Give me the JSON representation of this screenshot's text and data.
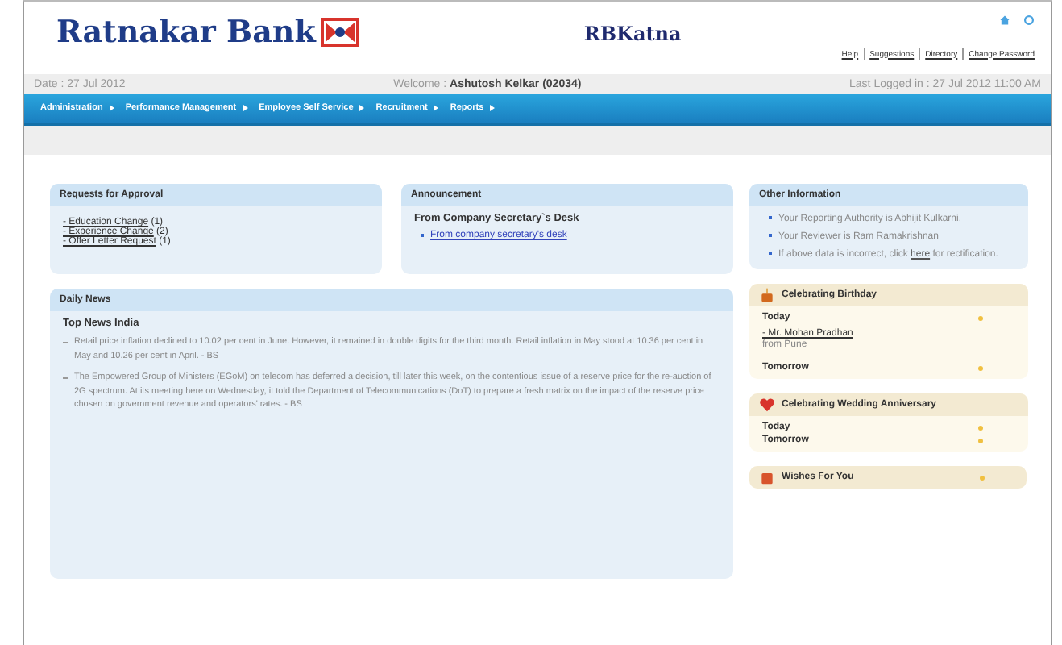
{
  "header": {
    "bank_name": "Ratnakar Bank",
    "product_name": "RBKatna",
    "links": [
      "Help",
      "Suggestions",
      "Directory",
      "Change Password"
    ]
  },
  "info_bar": {
    "date": "Date : 27 Jul 2012",
    "welcome_label": "Welcome :",
    "user": "Ashutosh Kelkar (02034)",
    "last_login": "Last Logged in : 27 Jul 2012 11:00 AM"
  },
  "nav": [
    "Administration",
    "Performance Management",
    "Employee Self Service",
    "Recruitment",
    "Reports"
  ],
  "requests": {
    "title": "Requests for Approval",
    "items": [
      {
        "link": "- Education Change",
        "count": "(1)"
      },
      {
        "link": "- Experience Change",
        "count": "(2)"
      },
      {
        "link": "- Offer Letter Request",
        "count": "(1)"
      }
    ]
  },
  "announcement": {
    "title": "Announcement",
    "heading": "From Company Secretary`s Desk",
    "items": [
      "From company secretary's desk"
    ]
  },
  "news": {
    "title": "Daily News",
    "heading": "Top News India",
    "items": [
      "Retail price inflation declined to 10.02 per cent in June. However, it remained in double digits for the third month. Retail inflation in May stood at 10.36 per cent in May and 10.26 per cent in April. - BS",
      "The Empowered Group of Ministers (EGoM) on telecom has deferred a decision, till later this week, on the contentious issue of a reserve price for the re-auction of 2G spectrum. At its meeting here on Wednesday, it told the Department of Telecommunications (DoT) to prepare a fresh matrix on the impact of the reserve price chosen on government revenue and operators' rates. - BS"
    ]
  },
  "other_info": {
    "title": "Other Information",
    "items": [
      "Your Reporting Authority is Abhijit Kulkarni.",
      "Your Reviewer is Ram Ramakrishnan"
    ],
    "note_before": "If above data is incorrect, click",
    "note_link": "here",
    "note_after": "for rectification."
  },
  "birthday": {
    "title": "Celebrating Birthday",
    "today": "Today",
    "people": [
      {
        "name": "- Mr. Mohan Pradhan",
        "place": "from Pune"
      }
    ],
    "tomorrow": "Tomorrow"
  },
  "anniversary": {
    "title": "Celebrating Wedding Anniversary",
    "today": "Today",
    "tomorrow": "Tomorrow"
  },
  "wishes": {
    "title": "Wishes For You"
  }
}
